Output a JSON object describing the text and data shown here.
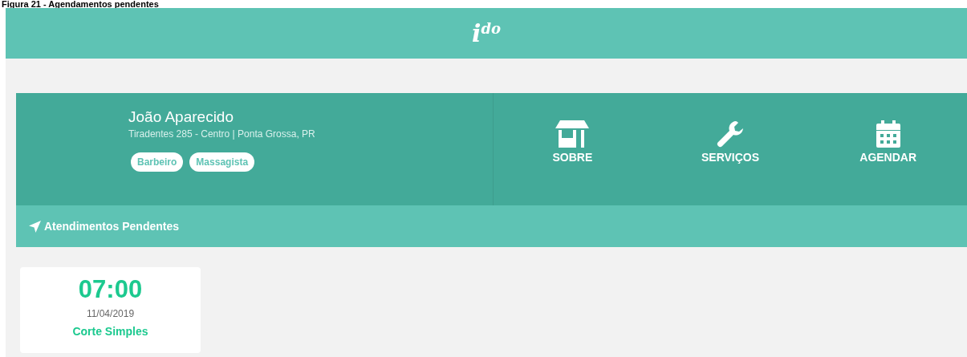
{
  "caption": "Figura 21 - Agendamentos pendentes",
  "header": {
    "logo_main": "i",
    "logo_sup": "do"
  },
  "profile": {
    "name": "João Aparecido",
    "address": "Tiradentes 285 - Centro | Ponta Grossa, PR",
    "tags": [
      "Barbeiro",
      "Massagista"
    ]
  },
  "nav": [
    {
      "kind": "store",
      "label": "SOBRE"
    },
    {
      "kind": "wrench",
      "label": "SERVIÇOS"
    },
    {
      "kind": "calendar",
      "label": "AGENDAR"
    }
  ],
  "section": {
    "title": "Atendimentos Pendentes"
  },
  "appointments": [
    {
      "time": "07:00",
      "date": "11/04/2019",
      "service": "Corte Simples"
    }
  ]
}
